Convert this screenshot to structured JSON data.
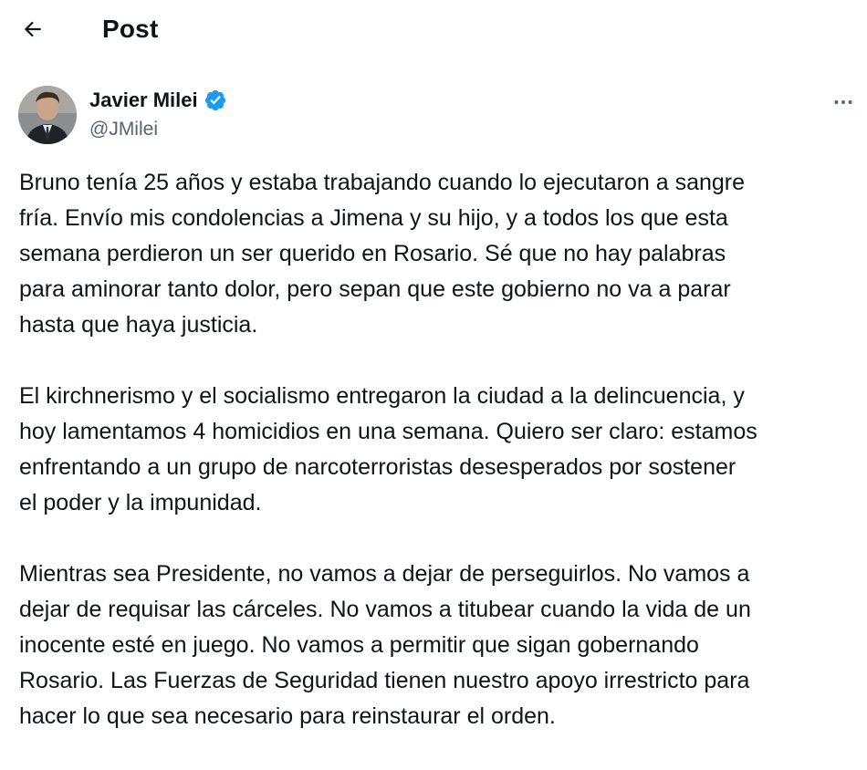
{
  "header": {
    "title": "Post",
    "back_icon": "arrow-left-icon"
  },
  "author": {
    "name": "Javier Milei",
    "handle": "@JMilei",
    "verified_icon": "verified-badge-icon",
    "verified_color": "#1d9bf0",
    "more_icon": "more-horizontal-icon"
  },
  "post": {
    "paragraphs": [
      "Bruno tenía 25 años y estaba trabajando cuando lo ejecutaron a sangre\nfría. Envío mis condolencias a Jimena y su hijo, y a todos los que esta\nsemana perdieron un ser querido en Rosario. Sé que no hay palabras\npara aminorar tanto dolor, pero sepan que este gobierno no va a parar\nhasta que haya justicia.",
      "El kirchnerismo y el socialismo entregaron la ciudad a la delincuencia, y\nhoy lamentamos 4 homicidios en una semana. Quiero ser claro: estamos\nenfrentando a un grupo de narcoterroristas desesperados por sostener\nel poder y la impunidad.",
      "Mientras sea Presidente, no vamos a dejar de perseguirlos. No vamos a\ndejar de requisar las cárceles. No vamos a titubear cuando la vida de un\ninocente esté en juego. No vamos a permitir que sigan gobernando\nRosario. Las Fuerzas de Seguridad tienen nuestro apoyo irrestricto para\nhacer lo que sea necesario para reinstaurar el orden."
    ]
  },
  "colors": {
    "text_primary": "#0f1419",
    "text_secondary": "#536471",
    "background": "#ffffff"
  }
}
